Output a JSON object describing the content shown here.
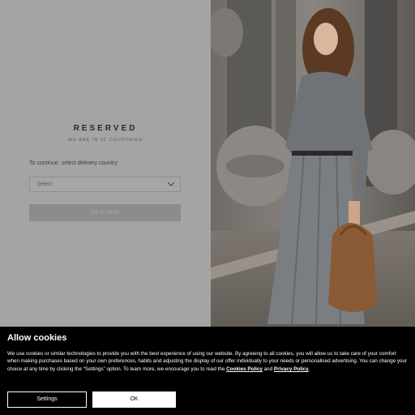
{
  "store_selector": {
    "brand": "RESERVED",
    "subtitle": "WE ARE IN 31 COUNTRIES",
    "delivery_label": "To continue, select delivery country",
    "select_value": "Select",
    "go_button_label": "Go to store"
  },
  "cookie_banner": {
    "title": "Allow cookies",
    "text_part1": "We use cookies or similar technologies to provide you with the best experience of using our website. By agreeing to all cookies, you will allow us to take care of your comfort when making purchases based on your own preferences, habits and adjusting the display of our offer individually to your needs or personalised advertising. You can change your choice at any time by clicking the “Settings” option. To learn more, we encourage you to read the",
    "cookies_policy_link": "Cookies Policy",
    "and_text": "and",
    "privacy_policy_link": "Privacy Policy",
    "settings_label": "Settings",
    "ok_label": "OK"
  },
  "icons": {
    "select_chevron": "chevron-down-icon"
  },
  "colors": {
    "overlay_gray": "#a4a4a4",
    "banner_background": "#000000",
    "ok_button_background": "#ffffff"
  }
}
